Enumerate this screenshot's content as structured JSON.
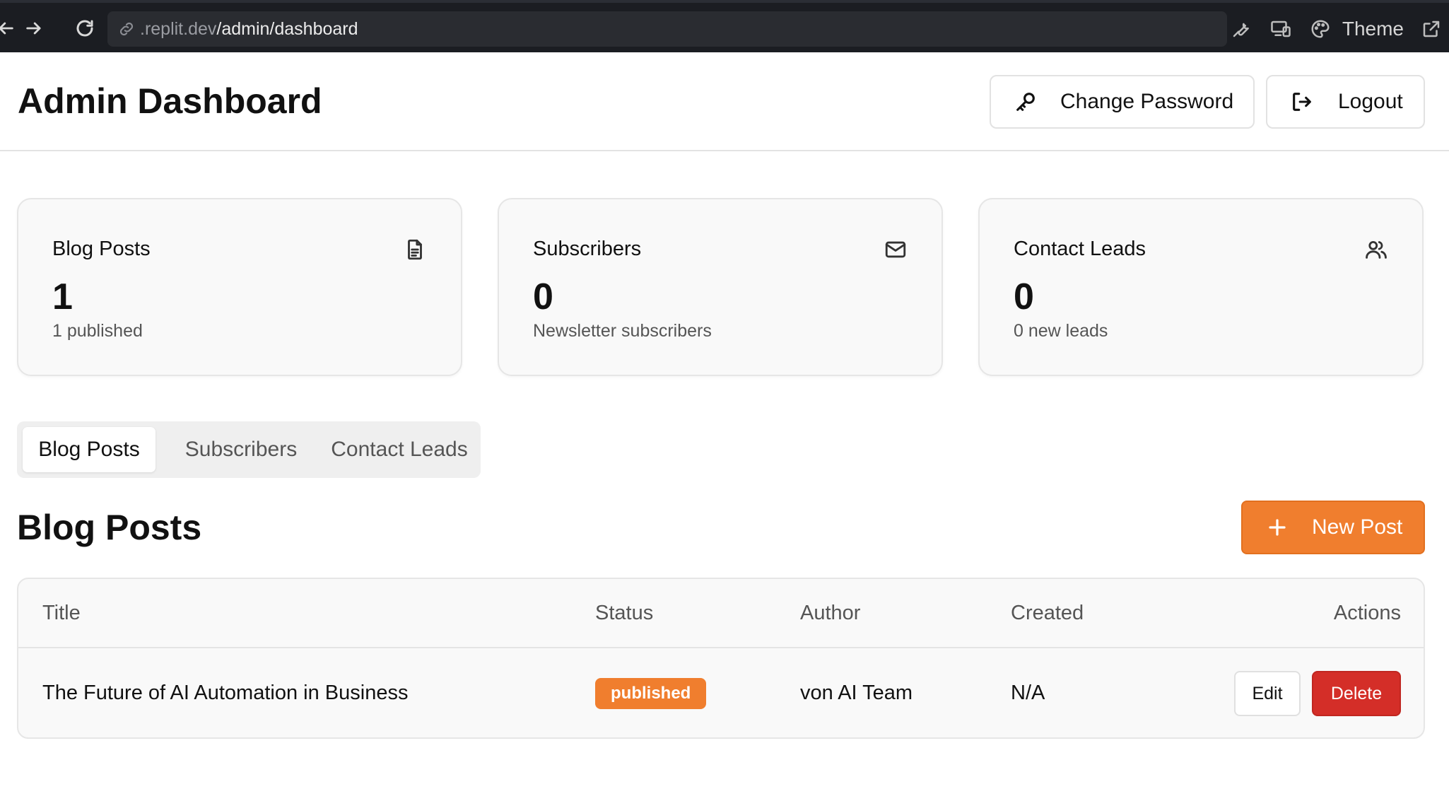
{
  "browser": {
    "url_host": ".replit.dev",
    "url_path": "/admin/dashboard",
    "theme_label": "Theme"
  },
  "header": {
    "title": "Admin Dashboard",
    "change_password_label": "Change Password",
    "logout_label": "Logout"
  },
  "stats": [
    {
      "title": "Blog Posts",
      "value": "1",
      "subtitle": "1 published",
      "icon": "document-icon"
    },
    {
      "title": "Subscribers",
      "value": "0",
      "subtitle": "Newsletter subscribers",
      "icon": "mail-icon"
    },
    {
      "title": "Contact Leads",
      "value": "0",
      "subtitle": "0 new leads",
      "icon": "users-icon"
    }
  ],
  "tabs": [
    {
      "label": "Blog Posts",
      "active": true
    },
    {
      "label": "Subscribers",
      "active": false
    },
    {
      "label": "Contact Leads",
      "active": false
    }
  ],
  "section": {
    "title": "Blog Posts",
    "new_post_label": "New Post"
  },
  "table": {
    "columns": [
      "Title",
      "Status",
      "Author",
      "Created",
      "Actions"
    ],
    "rows": [
      {
        "title": "The Future of AI Automation in Business",
        "status": "published",
        "author": "von AI Team",
        "created": "N/A",
        "edit_label": "Edit",
        "delete_label": "Delete"
      }
    ]
  },
  "colors": {
    "accent": "#f07e2e",
    "danger": "#d42e28",
    "chrome_bg": "#1b1d22"
  }
}
